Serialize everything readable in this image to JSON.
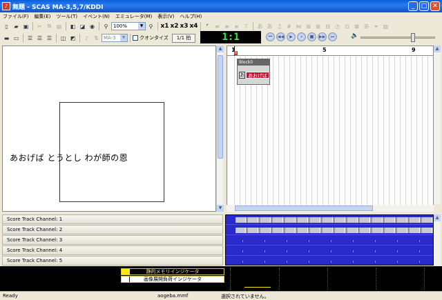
{
  "window": {
    "title": "無題 - SCAS MA-3,5,7/KDDI"
  },
  "menu": [
    "ファイル(F)",
    "編集(E)",
    "ツール(T)",
    "イベント(N)",
    "エミュレータ(M)",
    "表示(V)",
    "ヘルプ(H)"
  ],
  "toolbar": {
    "zoom_value": "100%",
    "speed_x1": "x1",
    "speed_x2": "x2",
    "speed_x3": "x3",
    "speed_x4": "x4",
    "model": "MA-3",
    "quantize_label": "クオンタイズ",
    "ratio_label": "1/1 拍"
  },
  "lcd": {
    "value": "1:1"
  },
  "stage": {
    "lyrics": "あおげば とうとし わが師の恩"
  },
  "timeline": {
    "ruler": [
      {
        "label": "1"
      },
      {
        "label": "5"
      },
      {
        "label": "9"
      }
    ],
    "marker": "0",
    "block_label": "Block0",
    "event_key": "あ",
    "event_text": "あおげば"
  },
  "tracks": [
    "Score   Track     Channel:  1",
    "Score   Track     Channel:  2",
    "Score   Track     Channel:  3",
    "Score   Track     Channel:  4",
    "Score   Track     Channel:  5"
  ],
  "meters": {
    "static_memory": "静的メモリインジケータ",
    "image_buffer": "画像展開負荷インジケータ"
  },
  "status": {
    "ready": "Ready",
    "file": "aogeba.mmf",
    "selection": "選択されていません。"
  }
}
